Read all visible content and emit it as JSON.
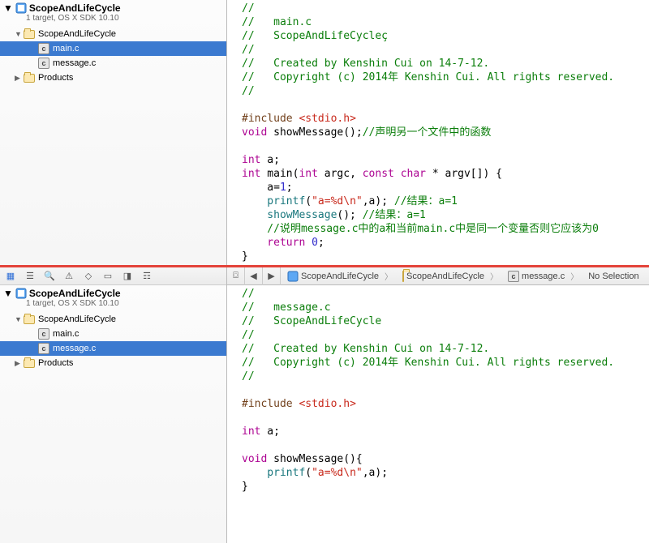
{
  "top": {
    "project": {
      "name": "ScopeAndLifeCycle",
      "subtitle": "1 target, OS X SDK 10.10"
    },
    "tree": {
      "root": "ScopeAndLifeCycle",
      "group": "ScopeAndLifeCycle",
      "file_main": "main.c",
      "file_message": "message.c",
      "products": "Products"
    },
    "code": {
      "c1": "//",
      "c2": "//   main.c",
      "c3": "//   ScopeAndLifeCycleç",
      "c4": "//",
      "c5": "//   Created by Kenshin Cui on 14-7-12.",
      "c6": "//   Copyright (c) 2014年 Kenshin Cui. All rights reserved.",
      "c7": "//",
      "inc": "#include ",
      "hdr": "<stdio.h>",
      "decl_kw": "void",
      "decl_fn": " showMessage();",
      "decl_cmt": "//声明另一个文件中的函数",
      "int": "int",
      "a": " a;",
      "main_kw1": "int",
      "main_name": " main(",
      "main_kw2": "int",
      "main_p1": " argc, ",
      "main_kw3": "const",
      "main_p2": " ",
      "main_kw4": "char",
      "main_p3": " * argv[]) {",
      "b1": "    a=",
      "b1n": "1",
      "b1e": ";",
      "b2f": "    printf",
      "b2p": "(",
      "b2s": "\"a=%d\\n\"",
      "b2r": ",a); ",
      "b2c": "//结果：a=1",
      "b3f": "    showMessage",
      "b3r": "(); ",
      "b3c": "//结果：a=1",
      "b4c": "    //说明message.c中的a和当前main.c中是同一个变量否则它应该为0",
      "b5k": "    return",
      "b5n": " 0",
      "b5e": ";",
      "close": "}"
    }
  },
  "bottom": {
    "project": {
      "name": "ScopeAndLifeCycle",
      "subtitle": "1 target, OS X SDK 10.10"
    },
    "tree": {
      "root": "ScopeAndLifeCycle",
      "group": "ScopeAndLifeCycle",
      "file_main": "main.c",
      "file_message": "message.c",
      "products": "Products"
    },
    "jumpbar": {
      "c1": "ScopeAndLifeCycle",
      "c2": "ScopeAndLifeCycle",
      "c3": "message.c",
      "c4": "No Selection"
    },
    "code": {
      "c1": "//",
      "c2": "//   message.c",
      "c3": "//   ScopeAndLifeCycle",
      "c4": "//",
      "c5": "//   Created by Kenshin Cui on 14-7-12.",
      "c6": "//   Copyright (c) 2014年 Kenshin Cui. All rights reserved.",
      "c7": "//",
      "inc": "#include ",
      "hdr": "<stdio.h>",
      "int": "int",
      "a": " a;",
      "fkw": "void",
      "fname": " showMessage(){",
      "b1f": "    printf",
      "b1p": "(",
      "b1s": "\"a=%d\\n\"",
      "b1r": ",a);",
      "close": "}"
    }
  }
}
